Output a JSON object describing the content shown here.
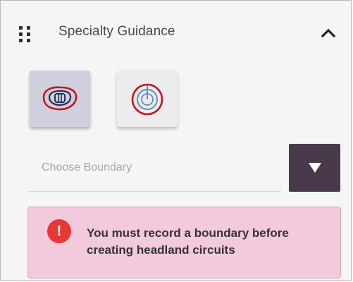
{
  "panel": {
    "title": "Specialty Guidance",
    "drag_handle_icon": "drag-handle-icon",
    "collapse_icon": "chevron-up-icon"
  },
  "modes": [
    {
      "icon": "boundary-mode-icon",
      "selected": true
    },
    {
      "icon": "pivot-mode-icon",
      "selected": false
    }
  ],
  "boundary": {
    "placeholder": "Choose Boundary",
    "dropdown_icon": "triangle-down-icon"
  },
  "alert": {
    "icon": "exclamation-icon",
    "icon_text": "!",
    "message": "You must record a boundary before creating headland circuits",
    "color": "#f3c9dc"
  },
  "colors": {
    "accent": "#483a4a",
    "selected_tile": "#cfcfdd",
    "alert_red": "#e53935",
    "icon_red": "#c4151c",
    "icon_blue": "#5f8fb8"
  }
}
